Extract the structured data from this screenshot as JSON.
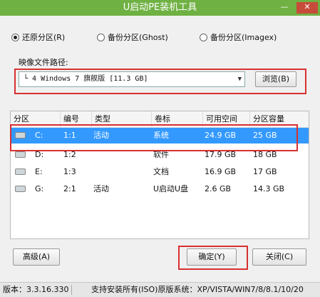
{
  "window": {
    "title": "U启动PE装机工具",
    "minimize": "—",
    "close": "✕"
  },
  "modes": [
    {
      "label": "还原分区(R)",
      "selected": true
    },
    {
      "label": "备份分区(Ghost)",
      "selected": false
    },
    {
      "label": "备份分区(Imagex)",
      "selected": false
    }
  ],
  "image_path": {
    "label": "映像文件路径:",
    "value": "└ 4 Windows 7 旗舰版 [11.3 GB]",
    "arrow": "▼",
    "browse_label": "浏览(B)"
  },
  "table": {
    "headers": [
      "分区",
      "编号",
      "类型",
      "卷标",
      "可用空间",
      "分区容量"
    ],
    "rows": [
      {
        "partition": "C:",
        "number": "1:1",
        "type": "活动",
        "label": "系统",
        "free": "24.9 GB",
        "capacity": "25 GB",
        "selected": true
      },
      {
        "partition": "D:",
        "number": "1:2",
        "type": "",
        "label": "软件",
        "free": "17.9 GB",
        "capacity": "18 GB",
        "selected": false
      },
      {
        "partition": "E:",
        "number": "1:3",
        "type": "",
        "label": "文档",
        "free": "16.9 GB",
        "capacity": "17 GB",
        "selected": false
      },
      {
        "partition": "G:",
        "number": "2:1",
        "type": "活动",
        "label": "U启动U盘",
        "free": "2.6 GB",
        "capacity": "14.3 GB",
        "selected": false
      }
    ]
  },
  "buttons": {
    "advanced": "高级(A)",
    "ok": "确定(Y)",
    "close": "关闭(C)"
  },
  "status": {
    "version": "版本：3.3.16.330",
    "systems": "支持安装所有(ISO)原版系统：XP/VISTA/WIN7/8/8.1/10/20"
  },
  "colors": {
    "titlebar": "#6fb143",
    "selection": "#3399ff",
    "highlight_box": "#d83030"
  }
}
